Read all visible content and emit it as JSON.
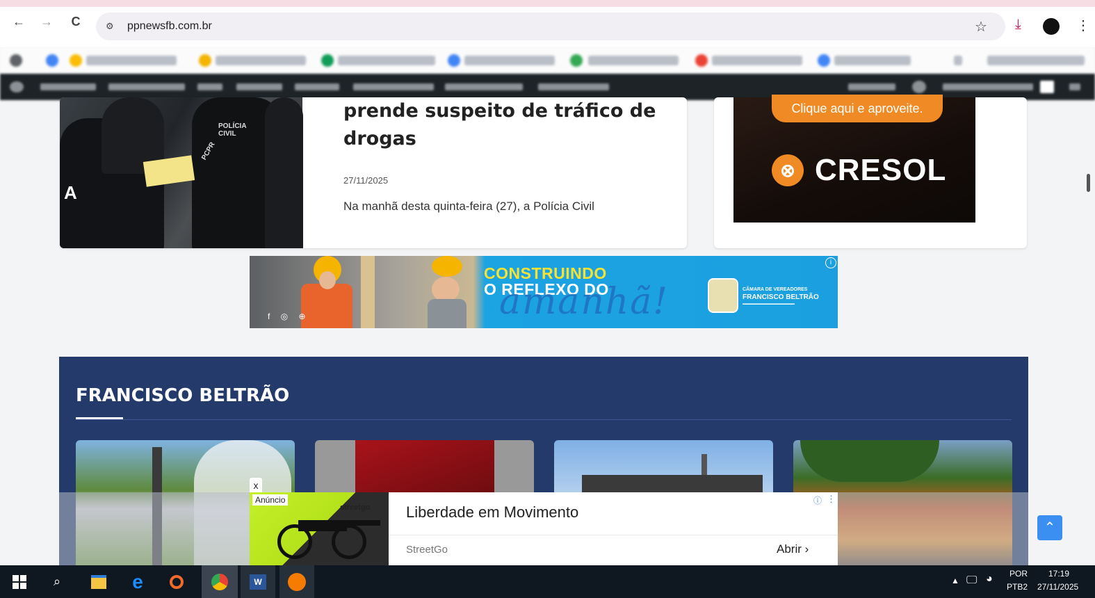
{
  "browser": {
    "url": "ppnewsfb.com.br",
    "back": "←",
    "forward": "→",
    "reload": "C"
  },
  "article": {
    "headline": "prende suspeito de tráfico de drogas",
    "date": "27/11/2025",
    "excerpt": "Na manhã desta quinta-feira (27), a Polícia Civil",
    "image_text": "A"
  },
  "cresol_ad": {
    "cta": "Clique aqui e aproveite.",
    "brand": "CRESOL"
  },
  "banner_ad": {
    "line1": "CONSTRUINDO",
    "line2": "O REFLEXO DO",
    "script": "amanhã!",
    "org_small": "CÂMARA DE VEREADORES",
    "org_big": "FRANCISCO BELTRÃO"
  },
  "section": {
    "title": "FRANCISCO BELTRÃO"
  },
  "bottom_ad": {
    "label": "Anúncio",
    "close": "x",
    "brand": "streetgo",
    "title": "Liberdade em Movimento",
    "advertiser": "StreetGo",
    "open": "Abrir"
  },
  "taskbar": {
    "lang1": "POR",
    "lang2": "PTB2",
    "time": "17:19",
    "date": "27/11/2025"
  },
  "colors": {
    "section_bg": "#233a6b",
    "accent_orange": "#f08a24",
    "to_top": "#3b8ff0"
  }
}
